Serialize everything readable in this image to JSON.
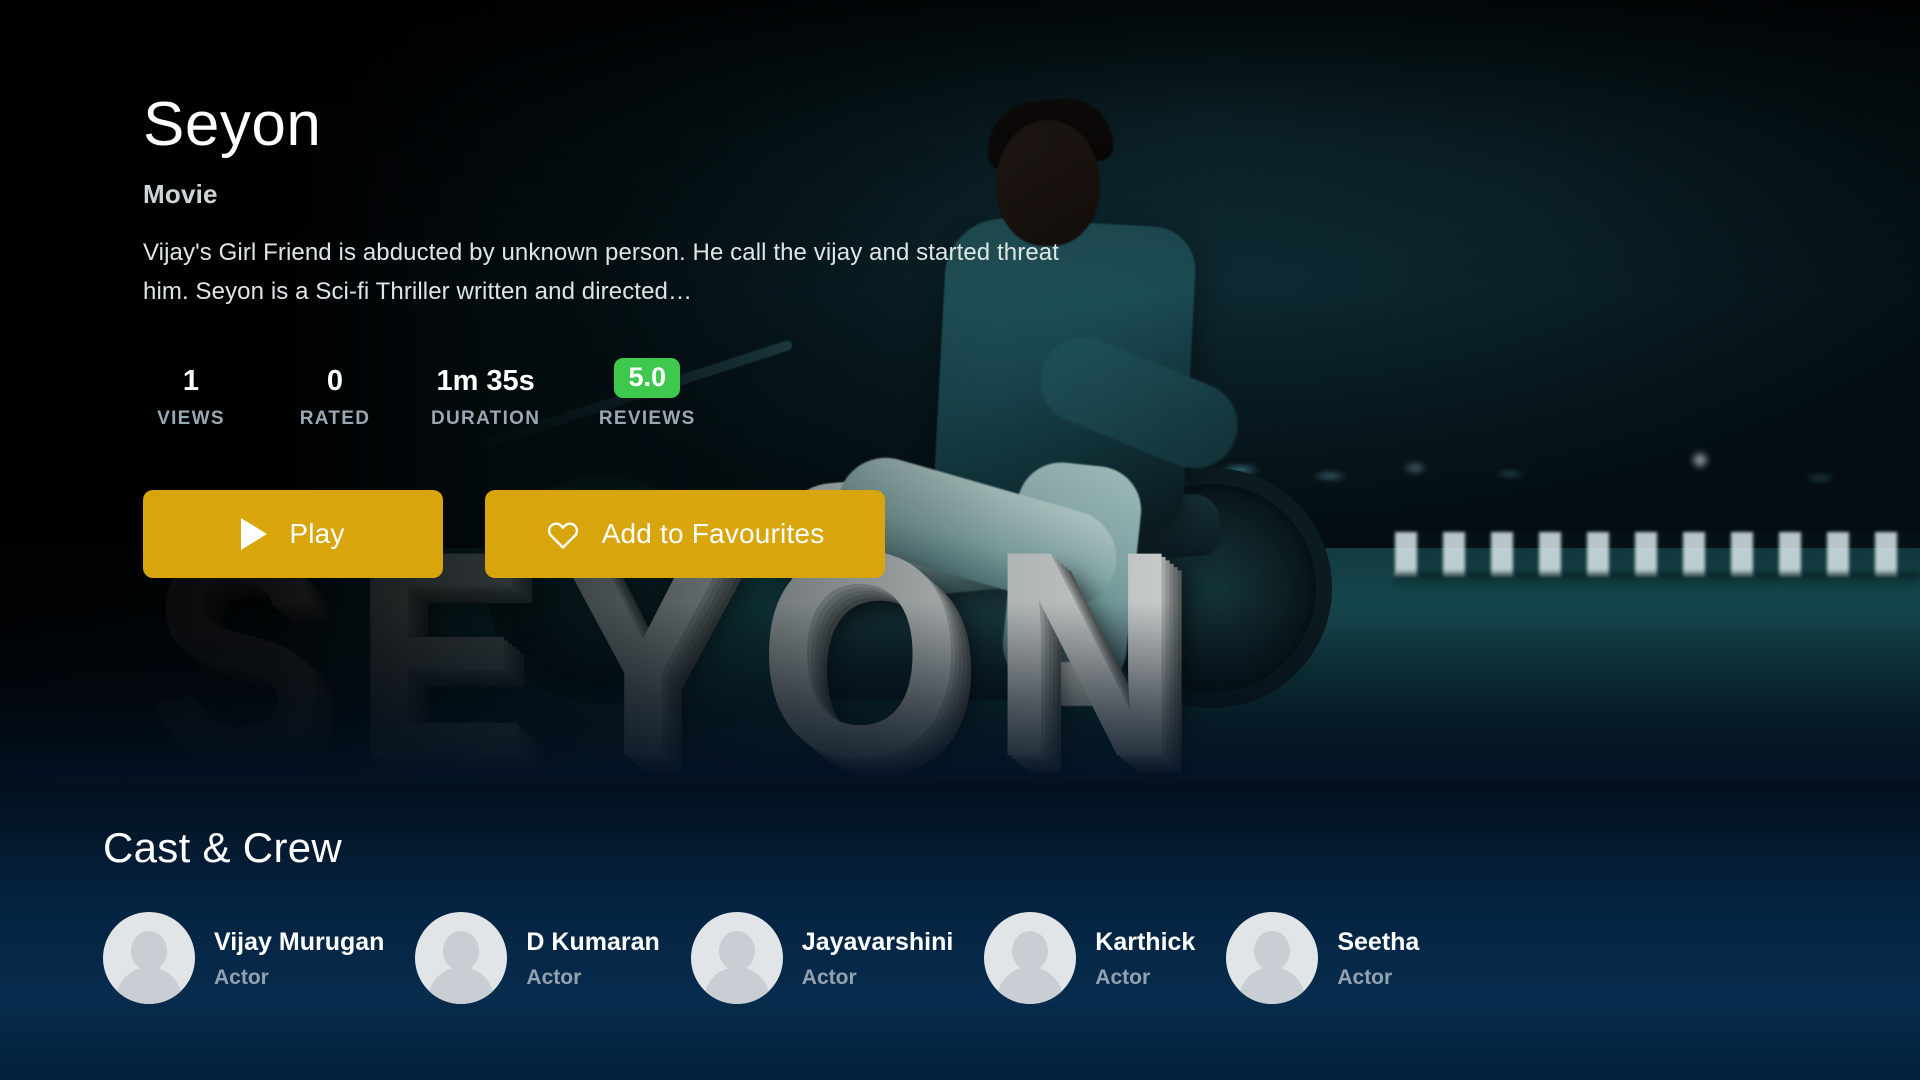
{
  "hero": {
    "title": "Seyon",
    "type": "Movie",
    "description": "Vijay's Girl Friend  is abducted by unknown person. He call the vijay and started threat him. Seyon is a Sci-fi Thriller written and directed…",
    "backdrop_title_text": "SEYON",
    "stats": [
      {
        "value": "1",
        "label": "VIEWS"
      },
      {
        "value": "0",
        "label": "RATED"
      },
      {
        "value": "1m 35s",
        "label": "DURATION"
      }
    ],
    "reviews": {
      "value": "5.0",
      "label": "REVIEWS",
      "badge_color": "#3ec84d"
    },
    "actions": {
      "play_label": "Play",
      "favourite_label": "Add to Favourites",
      "button_color": "#d9a50c"
    }
  },
  "cast": {
    "heading": "Cast & Crew",
    "members": [
      {
        "name": "Vijay Murugan",
        "role": "Actor"
      },
      {
        "name": "D Kumaran",
        "role": "Actor"
      },
      {
        "name": "Jayavarshini",
        "role": "Actor"
      },
      {
        "name": "Karthick",
        "role": "Actor"
      },
      {
        "name": "Seetha",
        "role": "Actor"
      }
    ]
  }
}
